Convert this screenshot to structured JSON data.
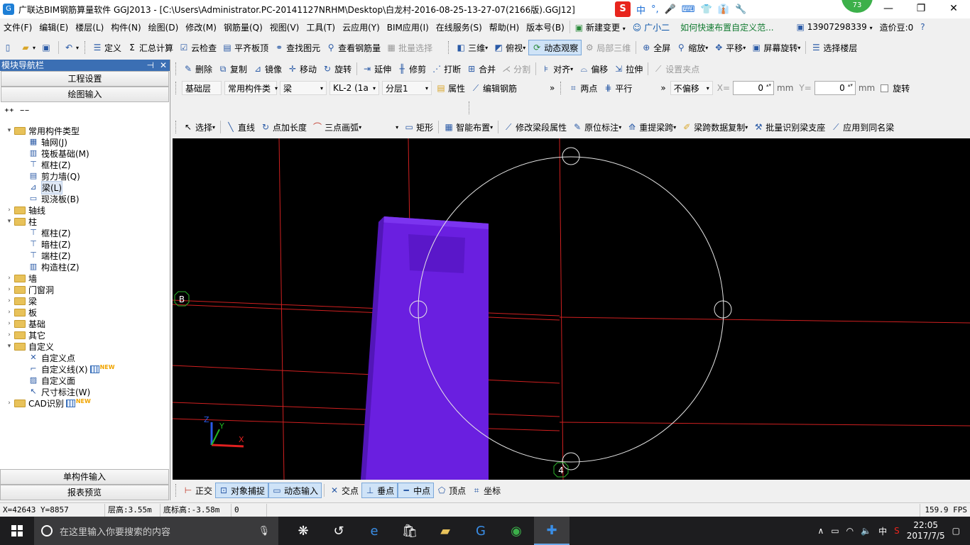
{
  "window": {
    "title": "广联达BIM钢筋算量软件 GGJ2013 - [C:\\Users\\Administrator.PC-20141127NRHM\\Desktop\\白龙村-2016-08-25-13-27-07(2166版).GGJ12]",
    "ime": [
      "中",
      "°,",
      "🎤",
      "⌨",
      "👕",
      "👔",
      "🔧"
    ],
    "badge": "73",
    "controls": [
      "—",
      "❐",
      "✕"
    ]
  },
  "menu": {
    "items": [
      "文件(F)",
      "编辑(E)",
      "楼层(L)",
      "构件(N)",
      "绘图(D)",
      "修改(M)",
      "钢筋量(Q)",
      "视图(V)",
      "工具(T)",
      "云应用(Y)",
      "BIM应用(I)",
      "在线服务(S)",
      "帮助(H)",
      "版本号(B)"
    ],
    "new_change": "新建变更",
    "guangxiaoer": "广小二",
    "help_link": "如何快速布置自定义范...",
    "phone": "13907298339",
    "price": "造价豆:0"
  },
  "toolbar1": {
    "define": "定义",
    "summary": "汇总计算",
    "cloud_check": "云检查",
    "flush_slab": "平齐板顶",
    "find_element": "查找图元",
    "view_rebar": "查看钢筋量",
    "batch_select": "批量选择",
    "three_d": "三维",
    "top_view": "俯视",
    "dynamic_view": "动态观察",
    "local_3d": "局部三维",
    "fullscreen": "全屏",
    "zoom": "缩放",
    "pan": "平移",
    "screen_rotate": "屏幕旋转",
    "select_floor": "选择楼层"
  },
  "panel": {
    "title": "模块导航栏",
    "tab_settings": "工程设置",
    "tab_draw": "绘图输入",
    "single_input": "单构件输入",
    "report_preview": "报表预览",
    "tree": [
      {
        "level": 0,
        "exp": "▾",
        "folder": true,
        "label": "常用构件类型"
      },
      {
        "level": 1,
        "icon": "▦",
        "label": "轴网(J)"
      },
      {
        "level": 1,
        "icon": "▥",
        "label": "筏板基础(M)"
      },
      {
        "level": 1,
        "icon": "⊤",
        "label": "框柱(Z)"
      },
      {
        "level": 1,
        "icon": "▤",
        "label": "剪力墙(Q)"
      },
      {
        "level": 1,
        "icon": "⊿",
        "label": "梁(L)",
        "selected": true
      },
      {
        "level": 1,
        "icon": "▭",
        "label": "现浇板(B)"
      },
      {
        "level": 0,
        "exp": "›",
        "folder": true,
        "label": "轴线"
      },
      {
        "level": 0,
        "exp": "▾",
        "folder": true,
        "label": "柱"
      },
      {
        "level": 1,
        "icon": "⊤",
        "label": "框柱(Z)"
      },
      {
        "level": 1,
        "icon": "⊤",
        "label": "暗柱(Z)"
      },
      {
        "level": 1,
        "icon": "⊤",
        "label": "端柱(Z)"
      },
      {
        "level": 1,
        "icon": "▥",
        "label": "构造柱(Z)"
      },
      {
        "level": 0,
        "exp": "›",
        "folder": true,
        "label": "墙"
      },
      {
        "level": 0,
        "exp": "›",
        "folder": true,
        "label": "门窗洞"
      },
      {
        "level": 0,
        "exp": "›",
        "folder": true,
        "label": "梁"
      },
      {
        "level": 0,
        "exp": "›",
        "folder": true,
        "label": "板"
      },
      {
        "level": 0,
        "exp": "›",
        "folder": true,
        "label": "基础"
      },
      {
        "level": 0,
        "exp": "›",
        "folder": true,
        "label": "其它"
      },
      {
        "level": 0,
        "exp": "▾",
        "folder": true,
        "label": "自定义"
      },
      {
        "level": 1,
        "icon": "✕",
        "label": "自定义点"
      },
      {
        "level": 1,
        "icon": "⌐",
        "label": "自定义线(X)",
        "new": true
      },
      {
        "level": 1,
        "icon": "▨",
        "label": "自定义面"
      },
      {
        "level": 1,
        "icon": "↖",
        "label": "尺寸标注(W)"
      },
      {
        "level": 0,
        "exp": "›",
        "folder": true,
        "label": "CAD识别",
        "new": true
      }
    ]
  },
  "toolbar2": {
    "delete": "删除",
    "copy": "复制",
    "mirror": "镜像",
    "move": "移动",
    "rotate": "旋转",
    "extend": "延伸",
    "trim": "修剪",
    "break": "打断",
    "merge": "合并",
    "split": "分割",
    "align": "对齐",
    "offset": "偏移",
    "stretch": "拉伸",
    "set_grip": "设置夹点"
  },
  "toolbar3": {
    "floor": "基础层",
    "category": "常用构件类",
    "type": "梁",
    "name": "KL-2 (1a",
    "layer": "分层1",
    "properties": "属性",
    "edit_rebar": "编辑钢筋",
    "two_points": "两点",
    "parallel": "平行",
    "offset_mode": "不偏移",
    "x_label": "X=",
    "x_value": "0",
    "y_label": "Y=",
    "y_value": "0",
    "unit": "mm",
    "rotate": "旋转"
  },
  "toolbar4": {
    "select": "选择",
    "line": "直线",
    "point_length": "点加长度",
    "three_arc": "三点画弧",
    "rect": "矩形",
    "smart": "智能布置",
    "modify_span": "修改梁段属性",
    "in_situ": "原位标注",
    "re_span": "重提梁跨",
    "copy_span": "梁跨数据复制",
    "batch_identify": "批量识别梁支座",
    "apply_same": "应用到同名梁"
  },
  "canvas": {
    "axis_b": "B",
    "axis_4": "4",
    "ucs_z": "Z",
    "ucs_y": "Y",
    "ucs_x": "X"
  },
  "snap": {
    "ortho": "正交",
    "osnap": "对象捕捉",
    "dyn_input": "动态输入",
    "intersection": "交点",
    "perpendicular": "垂点",
    "midpoint": "中点",
    "vertex": "顶点",
    "coordinate": "坐标"
  },
  "status": {
    "coords": "X=42643 Y=8857",
    "floor_height": "层高:3.55m",
    "bottom_elev": "底标高:-3.58m",
    "zero": "0",
    "fps": "159.9 FPS"
  },
  "taskbar": {
    "search_placeholder": "在这里输入你要搜索的内容",
    "ime": "中",
    "time": "22:05",
    "date": "2017/7/5"
  }
}
